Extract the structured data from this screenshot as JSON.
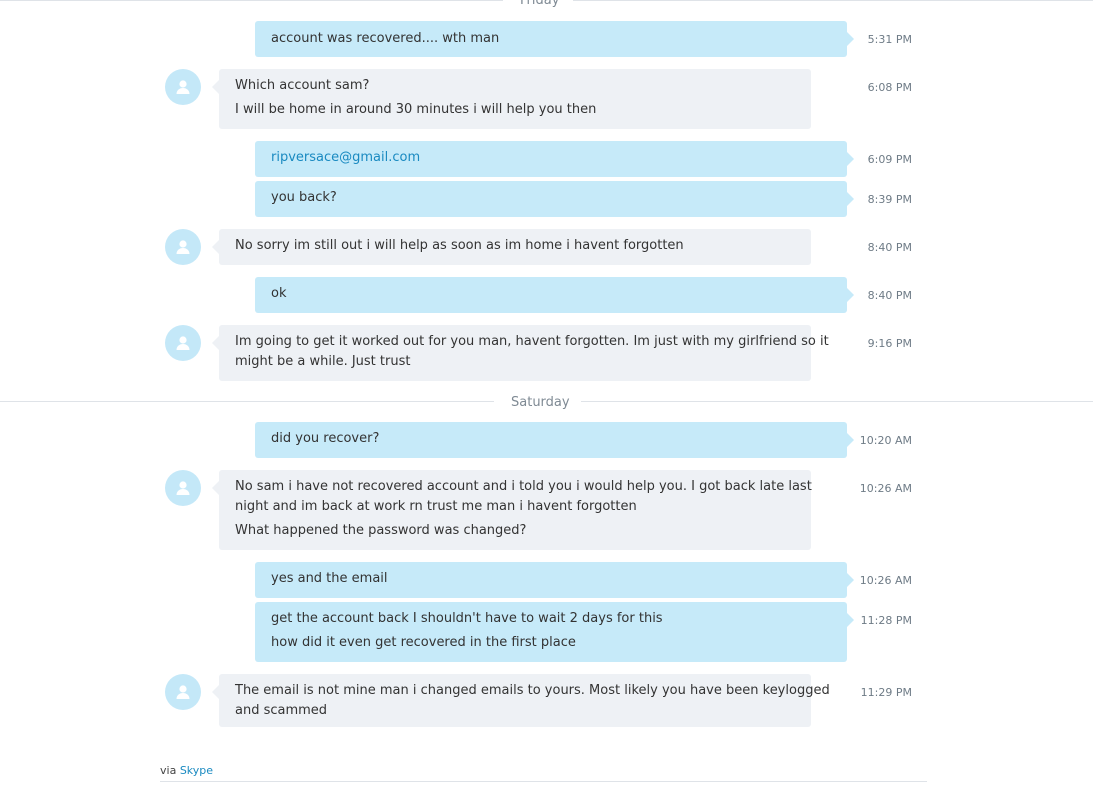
{
  "days": [
    {
      "label": "Friday"
    },
    {
      "label": "Saturday"
    }
  ],
  "messages": [
    {
      "dir": "out",
      "lines": [
        "account was recovered.... wth man"
      ],
      "time": "5:31 PM"
    },
    {
      "dir": "in",
      "lines": [
        "Which account sam?",
        "I will be home in around 30 minutes i will help you then"
      ],
      "time": "6:08 PM"
    },
    {
      "dir": "out",
      "lines": [
        "ripversace@gmail.com"
      ],
      "time": "6:09 PM"
    },
    {
      "dir": "out",
      "lines": [
        "you back?"
      ],
      "time": "8:39 PM"
    },
    {
      "dir": "in",
      "lines": [
        "No sorry im still out i will help as soon as im home i havent forgotten"
      ],
      "time": "8:40 PM"
    },
    {
      "dir": "out",
      "lines": [
        "ok"
      ],
      "time": "8:40 PM"
    },
    {
      "dir": "in",
      "lines": [
        "Im going to get it worked out for you man, havent forgotten. Im just with my girlfriend so it",
        "might be a while. Just trust"
      ],
      "time": "9:16 PM"
    },
    {
      "dir": "out",
      "lines": [
        "did you recover?"
      ],
      "time": "10:20 AM"
    },
    {
      "dir": "in",
      "lines": [
        "No sam i have not recovered account and i told you i would help you. I got back late last",
        "night and im back at work rn trust me man i havent forgotten",
        "What happened the password was changed?"
      ],
      "time": "10:26 AM"
    },
    {
      "dir": "out",
      "lines": [
        "yes and the email"
      ],
      "time": "10:26 AM"
    },
    {
      "dir": "out",
      "lines": [
        "get the account back I shouldn't have to wait 2 days for this",
        "how did it even get recovered in the first place"
      ],
      "time": "11:28 PM"
    },
    {
      "dir": "in",
      "lines": [
        "The email is not mine man i changed emails to yours. Most likely you have been keylogged",
        "and scammed"
      ],
      "time": "11:29 PM"
    }
  ],
  "footer": {
    "via": "via",
    "service": "Skype"
  },
  "colors": {
    "incoming_bubble": "#eef1f5",
    "outgoing_bubble": "#c6eaf9",
    "link": "#1a8ac1",
    "avatar": "#c4e8f8"
  },
  "icons": {
    "avatar": "person-icon"
  }
}
